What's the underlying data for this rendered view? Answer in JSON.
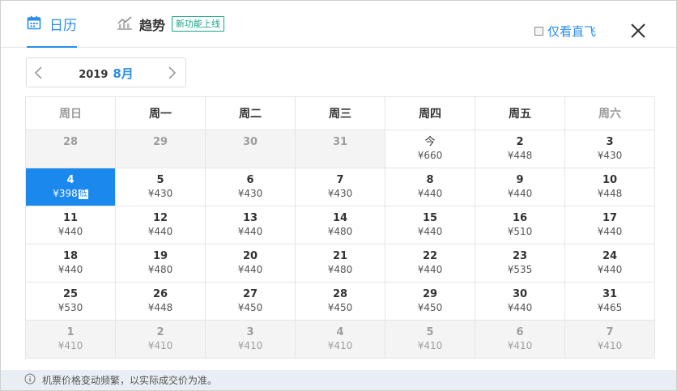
{
  "header": {
    "tabs": [
      {
        "label": "日历",
        "icon": "calendar-icon",
        "active": true
      },
      {
        "label": "趋势",
        "icon": "trend-chart-icon",
        "active": false,
        "badge": "新功能上线"
      }
    ],
    "direct_only": {
      "label": "仅看直飞",
      "checked": false
    },
    "close_icon": "close-icon"
  },
  "month_nav": {
    "year": "2019",
    "month": "8月"
  },
  "calendar": {
    "weekdays": [
      {
        "label": "周日",
        "weekend": true
      },
      {
        "label": "周一",
        "weekend": false
      },
      {
        "label": "周二",
        "weekend": false
      },
      {
        "label": "周三",
        "weekend": false
      },
      {
        "label": "周四",
        "weekend": false
      },
      {
        "label": "周五",
        "weekend": false
      },
      {
        "label": "周六",
        "weekend": true
      }
    ],
    "weeks": [
      [
        {
          "day": "28",
          "price": "",
          "muted": true
        },
        {
          "day": "29",
          "price": "",
          "muted": true
        },
        {
          "day": "30",
          "price": "",
          "muted": true
        },
        {
          "day": "31",
          "price": "",
          "muted": true
        },
        {
          "day": "今",
          "price": "¥660",
          "today": true
        },
        {
          "day": "2",
          "price": "¥448"
        },
        {
          "day": "3",
          "price": "¥430"
        }
      ],
      [
        {
          "day": "4",
          "price": "¥398",
          "selected": true,
          "tag": "低"
        },
        {
          "day": "5",
          "price": "¥430"
        },
        {
          "day": "6",
          "price": "¥430"
        },
        {
          "day": "7",
          "price": "¥430"
        },
        {
          "day": "8",
          "price": "¥440"
        },
        {
          "day": "9",
          "price": "¥440"
        },
        {
          "day": "10",
          "price": "¥448"
        }
      ],
      [
        {
          "day": "11",
          "price": "¥440"
        },
        {
          "day": "12",
          "price": "¥440"
        },
        {
          "day": "13",
          "price": "¥440"
        },
        {
          "day": "14",
          "price": "¥480"
        },
        {
          "day": "15",
          "price": "¥440"
        },
        {
          "day": "16",
          "price": "¥510"
        },
        {
          "day": "17",
          "price": "¥440"
        }
      ],
      [
        {
          "day": "18",
          "price": "¥440"
        },
        {
          "day": "19",
          "price": "¥480"
        },
        {
          "day": "20",
          "price": "¥440"
        },
        {
          "day": "21",
          "price": "¥480"
        },
        {
          "day": "22",
          "price": "¥440"
        },
        {
          "day": "23",
          "price": "¥535"
        },
        {
          "day": "24",
          "price": "¥440"
        }
      ],
      [
        {
          "day": "25",
          "price": "¥530"
        },
        {
          "day": "26",
          "price": "¥448"
        },
        {
          "day": "27",
          "price": "¥450"
        },
        {
          "day": "28",
          "price": "¥450"
        },
        {
          "day": "29",
          "price": "¥450"
        },
        {
          "day": "30",
          "price": "¥440"
        },
        {
          "day": "31",
          "price": "¥465"
        }
      ],
      [
        {
          "day": "1",
          "price": "¥410",
          "muted": true
        },
        {
          "day": "2",
          "price": "¥410",
          "muted": true
        },
        {
          "day": "3",
          "price": "¥410",
          "muted": true
        },
        {
          "day": "4",
          "price": "¥410",
          "muted": true
        },
        {
          "day": "5",
          "price": "¥410",
          "muted": true
        },
        {
          "day": "6",
          "price": "¥410",
          "muted": true
        },
        {
          "day": "7",
          "price": "¥410",
          "muted": true
        }
      ]
    ]
  },
  "footer": {
    "icon": "info-icon",
    "text": "机票价格变动频繁，以实际成交价为准。"
  },
  "colors": {
    "accent": "#2a8ee8",
    "selected": "#1b88ee",
    "badge": "#1aa38a",
    "muted_bg": "#f4f4f4",
    "footer_bg": "#e9eef5"
  }
}
